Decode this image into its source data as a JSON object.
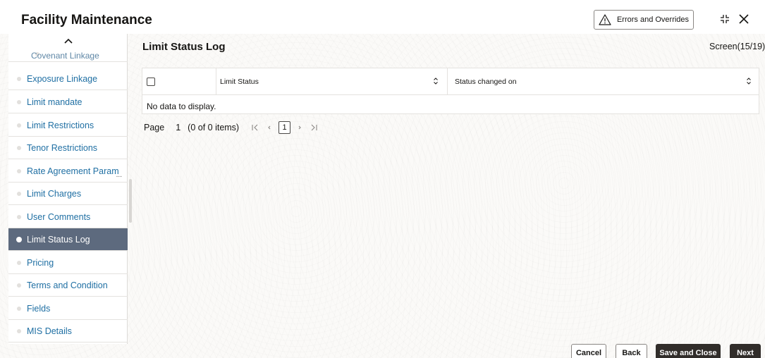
{
  "header": {
    "title": "Facility Maintenance",
    "errors_button_label": "Errors and Overrides"
  },
  "sidebar": {
    "items": [
      {
        "label": "Covenant Linkage"
      },
      {
        "label": "Exposure Linkage"
      },
      {
        "label": "Limit mandate"
      },
      {
        "label": "Limit Restrictions"
      },
      {
        "label": "Tenor Restrictions"
      },
      {
        "label": "Rate Agreement Param"
      },
      {
        "label": "Limit Charges"
      },
      {
        "label": "User Comments"
      },
      {
        "label": "Limit Status Log"
      },
      {
        "label": "Pricing"
      },
      {
        "label": "Terms and Condition"
      },
      {
        "label": "Fields"
      },
      {
        "label": "MIS Details"
      }
    ],
    "active_item": "Limit Status Log",
    "more_indicator": "..."
  },
  "main": {
    "section_title": "Limit Status Log",
    "screen_indicator": "Screen(15/19)",
    "table": {
      "columns": [
        "Limit Status",
        "Status changed on"
      ],
      "empty_message": "No data to display."
    },
    "pagination": {
      "page_label": "Page",
      "page_number": "1",
      "items_info": "(0 of 0 items)",
      "current_page_box": "1"
    }
  },
  "footer": {
    "cancel_label": "Cancel",
    "back_label": "Back",
    "save_close_label": "Save and Close",
    "next_label": "Next"
  },
  "colors": {
    "link": "#1f6fa3",
    "active_item_bg": "#5d6a7e",
    "primary_button_bg": "#312d2a"
  }
}
